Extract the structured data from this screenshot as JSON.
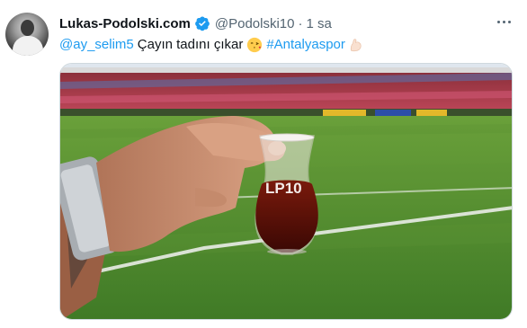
{
  "tweet": {
    "author_name": "Lukas-Podolski.com",
    "author_handle": "@Podolski10",
    "separator": "·",
    "time": "1 sa",
    "reply_to": "@ay_selim5",
    "text": "Çayın tadını çıkar",
    "hashtag": "#Antalyaspor",
    "cup_label": "LP10"
  },
  "icons": {
    "verified": "verified-badge-icon",
    "more": "more-options-icon",
    "emoji_kiss": "face-blowing-kiss-icon",
    "emoji_flex": "flexed-biceps-icon"
  },
  "colors": {
    "link": "#1d9bf0",
    "muted": "#536471",
    "grass": "#4f8a2e",
    "tea": "#5a0f08"
  }
}
